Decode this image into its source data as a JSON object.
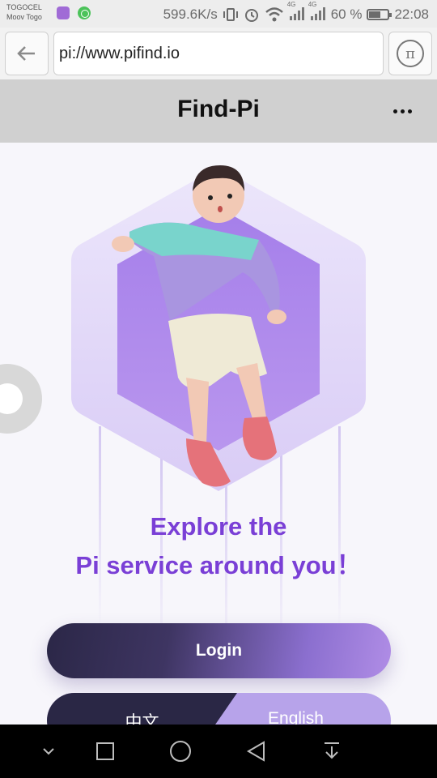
{
  "status_bar": {
    "carrier_1": "TOGOCEL",
    "carrier_2": "Moov Togo",
    "speed": "599.6K/s",
    "network_1": "4G",
    "network_2": "4G",
    "battery": "60 %",
    "time": "22:08"
  },
  "browser": {
    "url": "pi://www.pifind.io"
  },
  "header": {
    "title": "Find-Pi"
  },
  "hero": {
    "line_1": "Explore the",
    "line_2": "Pi service around you！"
  },
  "actions": {
    "login_label": "Login",
    "lang_zh": "中文",
    "lang_en": "English"
  },
  "colors": {
    "accent": "#7a3fd6",
    "dark": "#2a2745",
    "light_purple": "#b7a3ea"
  }
}
